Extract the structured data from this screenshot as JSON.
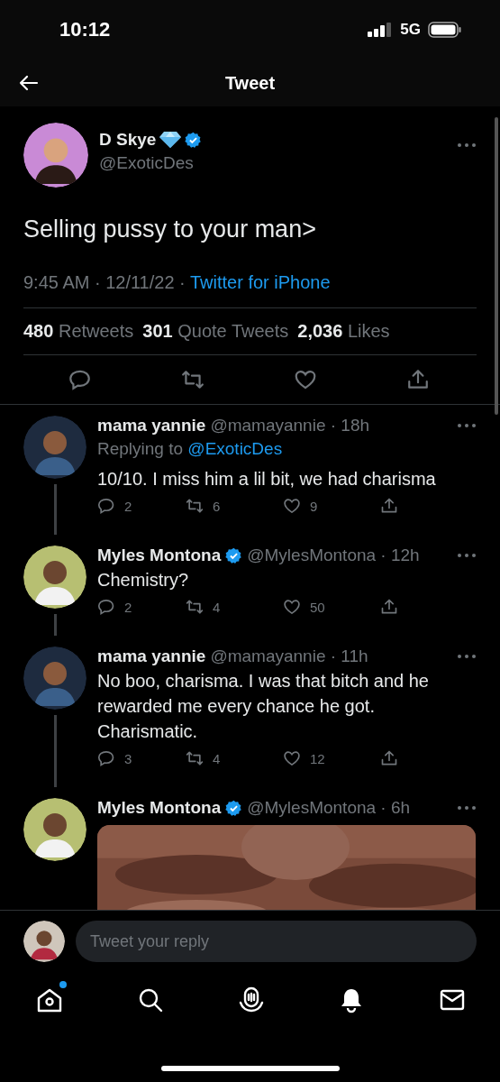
{
  "status_bar": {
    "time": "10:12",
    "network": "5G"
  },
  "header": {
    "title": "Tweet"
  },
  "tweet": {
    "name": "D Skye",
    "verified": true,
    "handle": "@ExoticDes",
    "text": "Selling pussy to your man>",
    "time": "9:45 AM ·",
    "date": "12/11/22 ·",
    "source": "Twitter for iPhone",
    "stats": [
      {
        "count": "480",
        "label": "Retweets"
      },
      {
        "count": "301",
        "label": "Quote Tweets"
      },
      {
        "count": "2,036",
        "label": "Likes"
      }
    ]
  },
  "replies": [
    {
      "name": "mama yannie",
      "verified": false,
      "handle": "@mamayannie",
      "age": "· 18h",
      "replying_to": "@ExoticDes",
      "replying_label": "Replying to",
      "text": "10/10. I miss him a lil bit, we had charisma",
      "replies": "2",
      "retweets": "6",
      "likes": "9",
      "thread": true
    },
    {
      "name": "Myles Montona",
      "verified": true,
      "handle": "@MylesMontona",
      "age": "· 12h",
      "text": "Chemistry?",
      "replies": "2",
      "retweets": "4",
      "likes": "50",
      "thread": true
    },
    {
      "name": "mama yannie",
      "verified": false,
      "handle": "@mamayannie",
      "age": "· 11h",
      "text": "No boo, charisma. I was that bitch and he rewarded me every chance he got. Charismatic.",
      "replies": "3",
      "retweets": "4",
      "likes": "12",
      "thread": true
    },
    {
      "name": "Myles Montona",
      "verified": true,
      "handle": "@MylesMontona",
      "age": "· 6h",
      "thread": false
    }
  ],
  "composer": {
    "placeholder": "Tweet your reply"
  },
  "nav": [
    {
      "kind": "home",
      "dot": true
    },
    {
      "kind": "search",
      "dot": false
    },
    {
      "kind": "spaces",
      "dot": false
    },
    {
      "kind": "notifications",
      "dot": false
    },
    {
      "kind": "messages",
      "dot": false
    }
  ]
}
